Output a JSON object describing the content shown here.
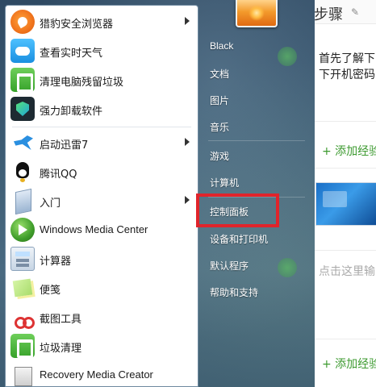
{
  "background_page": {
    "step_title": "步骤",
    "edit_icon": "pencil-icon",
    "line1": "首先了解下",
    "line2": "下开机密码",
    "add_exp_1": "+ 添加经验",
    "click_hint": "点击这里输",
    "add_exp_2": "+ 添加经验"
  },
  "start_menu": {
    "programs": [
      {
        "label": "猎豹安全浏览器",
        "icon": "cheetah-browser-icon",
        "submenu": true
      },
      {
        "label": "查看实时天气",
        "icon": "weather-icon",
        "submenu": false
      },
      {
        "label": "清理电脑残留垃圾",
        "icon": "cleanup-icon",
        "submenu": false
      },
      {
        "label": "强力卸载软件",
        "icon": "uninstall-icon",
        "submenu": false
      },
      {
        "label": "启动迅雷7",
        "icon": "thunder-icon",
        "submenu": true
      },
      {
        "label": "腾讯QQ",
        "icon": "qq-penguin-icon",
        "submenu": false
      },
      {
        "label": "入门",
        "icon": "getting-started-icon",
        "submenu": true
      },
      {
        "label": "Windows Media Center",
        "icon": "media-center-icon",
        "submenu": false
      },
      {
        "label": "计算器",
        "icon": "calculator-icon",
        "submenu": false
      },
      {
        "label": "便笺",
        "icon": "sticky-notes-icon",
        "submenu": false
      },
      {
        "label": "截图工具",
        "icon": "snipping-tool-icon",
        "submenu": false
      },
      {
        "label": "垃圾清理",
        "icon": "trash-clean-icon",
        "submenu": false
      },
      {
        "label": "Recovery Media Creator",
        "icon": "recovery-icon",
        "submenu": false
      }
    ],
    "right_items": [
      {
        "label": "Black"
      },
      {
        "label": "文档"
      },
      {
        "label": "图片"
      },
      {
        "label": "音乐"
      },
      {
        "label": "游戏"
      },
      {
        "label": "计算机"
      },
      {
        "label": "控制面板"
      },
      {
        "label": "设备和打印机"
      },
      {
        "label": "默认程序"
      },
      {
        "label": "帮助和支持"
      }
    ],
    "highlight_color": "#e0242b"
  }
}
